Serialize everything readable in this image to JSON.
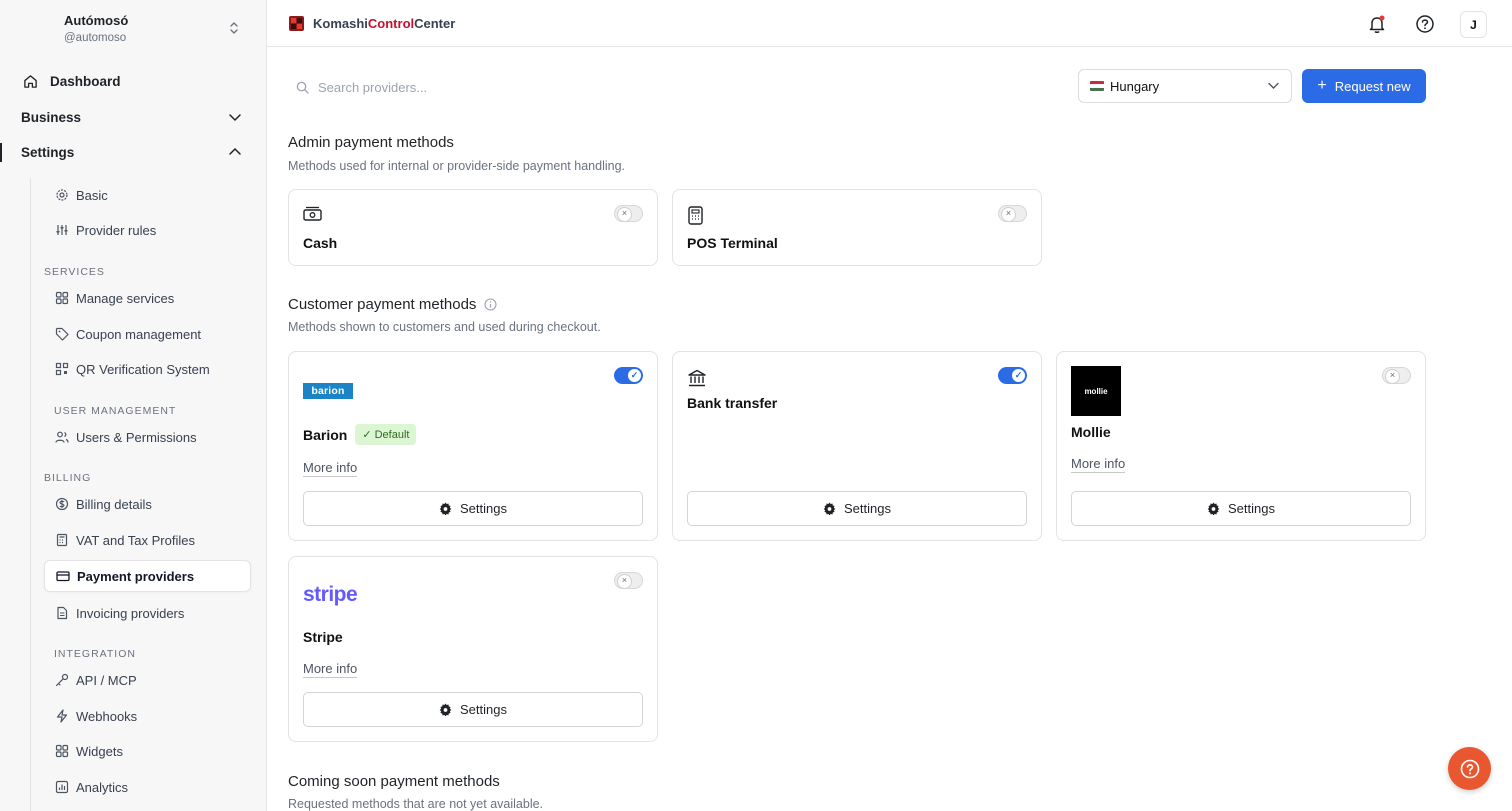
{
  "workspace": {
    "name": "Autómosó",
    "handle": "@automoso"
  },
  "nav": {
    "dashboard": "Dashboard",
    "business": "Business",
    "settings": "Settings",
    "basic": "Basic",
    "provider_rules": "Provider rules",
    "services_section": "SERVICES",
    "manage_services": "Manage services",
    "coupon_management": "Coupon management",
    "qr_verification": "QR Verification System",
    "user_management_section": "USER MANAGEMENT",
    "users_permissions": "Users & Permissions",
    "billing_section": "BILLING",
    "billing_details": "Billing details",
    "vat_tax": "VAT and Tax Profiles",
    "payment_providers": "Payment providers",
    "invoicing_providers": "Invoicing providers",
    "integration_section": "INTEGRATION",
    "api_mcp": "API / MCP",
    "webhooks": "Webhooks",
    "widgets": "Widgets",
    "analytics": "Analytics"
  },
  "header": {
    "brand_part1": "Komashi ",
    "brand_part2": "Control",
    "brand_part3": " Center",
    "avatar_initial": "J"
  },
  "toolbar": {
    "search_placeholder": "Search providers...",
    "country": "Hungary",
    "request_new": "Request new"
  },
  "admin": {
    "title": "Admin payment methods",
    "description": "Methods used for internal or provider-side payment handling.",
    "cards": [
      {
        "name": "Cash",
        "enabled": false
      },
      {
        "name": "POS Terminal",
        "enabled": false
      }
    ]
  },
  "customer": {
    "title": "Customer payment methods",
    "description": "Methods shown to customers and used during checkout.",
    "default_badge": "✓ Default",
    "more_info": "More info",
    "settings": "Settings",
    "cards": [
      {
        "name": "Barion",
        "logo_text": "barion",
        "enabled": true
      },
      {
        "name": "Bank transfer",
        "enabled": true
      },
      {
        "name": "Mollie",
        "logo_text": "mollie",
        "enabled": false
      },
      {
        "name": "Stripe",
        "logo_text": "stripe",
        "enabled": false
      }
    ]
  },
  "coming_soon": {
    "title": "Coming soon payment methods",
    "description": "Requested methods that are not yet available."
  },
  "colors": {
    "accent": "#2b6be6",
    "brand_red": "#c8102e",
    "fab": "#e8572f"
  }
}
